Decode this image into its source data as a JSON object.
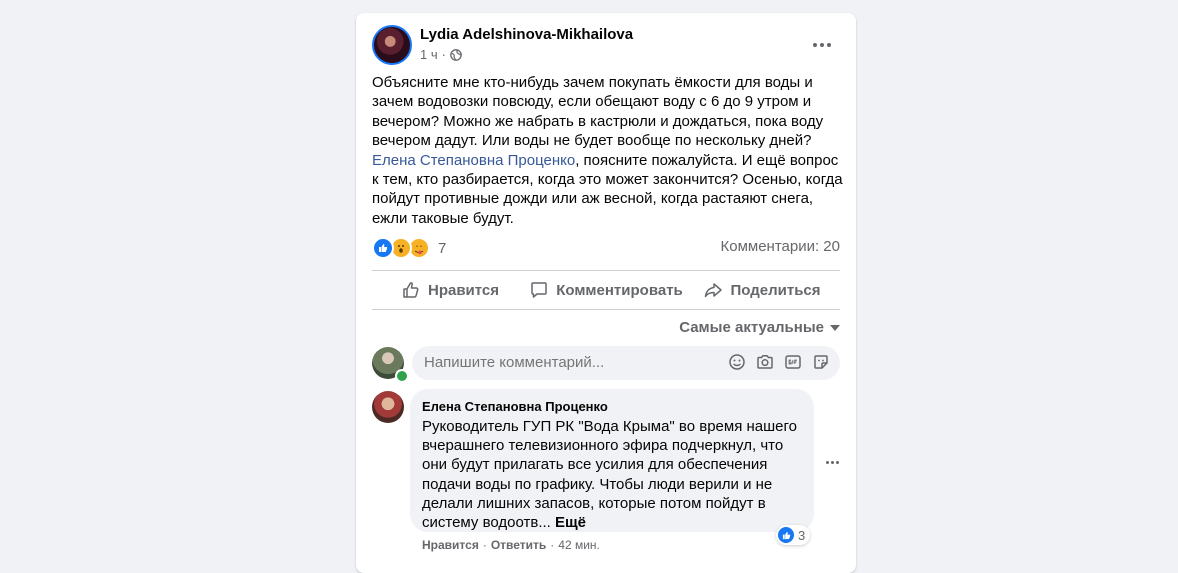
{
  "post": {
    "author": "Lydia Adelshinova-Mikhailova",
    "time": "1 ч",
    "privacy_icon": "globe-icon",
    "more_icon": "more-horizontal-icon",
    "text_before_mention": "Объясните мне кто-нибудь зачем покупать ёмкости для воды и зачем водовозки повсюду, если обещают воду с 6 до 9 утром и вечером? Можно же набрать  в кастрюли и дождаться, пока воду вечером дадут. Или воды не будет вообще по нескольку дней?",
    "mention": "Елена Степановна Проценко",
    "text_after_mention": ",  поясните пожалуйста. И ещё вопрос к тем, кто разбирается, когда это может закончится? Осенью, когда пойдут противные дожди или аж весной, когда растаяют снега, ежли таковые будут.",
    "reaction_count": "7",
    "reaction_icons": [
      "like-icon",
      "wow-icon",
      "care-icon"
    ],
    "comments_count": "Комментарии: 20"
  },
  "actions": {
    "like": "Нравится",
    "comment": "Комментировать",
    "share": "Поделиться"
  },
  "sort_label": "Самые актуальные",
  "composer": {
    "placeholder": "Напишите комментарий...",
    "icons": [
      "emoji-icon",
      "camera-icon",
      "gif-icon",
      "sticker-icon"
    ]
  },
  "comment": {
    "author": "Елена Степановна Проценко",
    "text": "Руководитель ГУП РК \"Вода Крыма\" во время нашего вчерашнего телевизионного эфира подчеркнул, что они будут прилагать все усилия для обеспечения подачи воды по графику. Чтобы люди верили и не делали лишних запасов, которые потом пойдут в систему водоотв...",
    "see_more": "Ещё",
    "reaction_count": "3",
    "like": "Нравится",
    "reply": "Ответить",
    "time": "42 мин.",
    "separator": "·"
  },
  "colors": {
    "accent": "#1877f2",
    "mention": "#385898",
    "secondary_text": "#65676b",
    "background": "#f0f2f5"
  }
}
